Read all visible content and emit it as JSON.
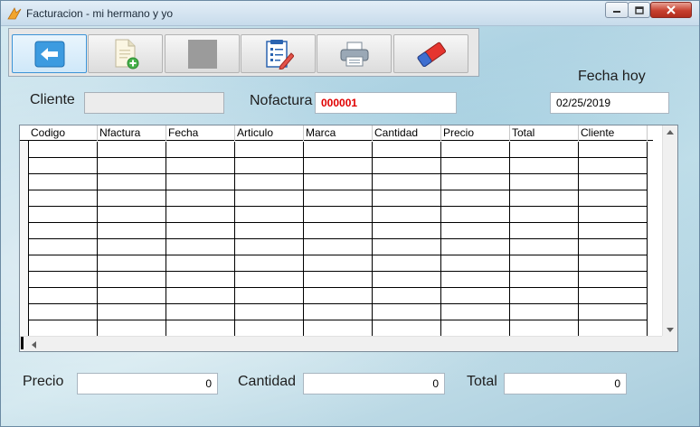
{
  "window": {
    "title": "Facturacion - mi hermano y yo"
  },
  "toolbar": {
    "buttons": [
      {
        "name": "back",
        "icon": "back-arrow-icon"
      },
      {
        "name": "new",
        "icon": "new-document-icon"
      },
      {
        "name": "stop",
        "icon": "gray-square-icon"
      },
      {
        "name": "edit",
        "icon": "edit-list-icon"
      },
      {
        "name": "print",
        "icon": "printer-icon"
      },
      {
        "name": "erase",
        "icon": "eraser-icon"
      }
    ]
  },
  "form": {
    "cliente_label": "Cliente",
    "cliente_value": "",
    "nofactura_label": "Nofactura",
    "nofactura_value": "000001",
    "fecha_label": "Fecha hoy",
    "fecha_value": "02/25/2019"
  },
  "grid": {
    "columns": [
      "Codigo",
      "Nfactura",
      "Fecha",
      "Articulo",
      "Marca",
      "Cantidad",
      "Precio",
      "Total",
      "Cliente"
    ],
    "row_count": 12
  },
  "totals": {
    "precio_label": "Precio",
    "precio_value": "0",
    "cantidad_label": "Cantidad",
    "cantidad_value": "0",
    "total_label": "Total",
    "total_value": "0"
  },
  "colors": {
    "accent_red": "#e00000",
    "selected_button": "#3c93d6"
  }
}
